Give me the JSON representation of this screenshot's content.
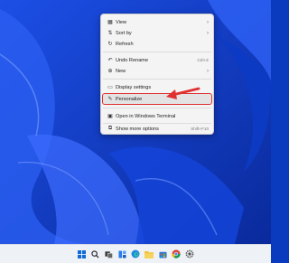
{
  "context_menu": {
    "items": [
      {
        "label": "View",
        "icon": "view-grid-icon",
        "submenu": true
      },
      {
        "label": "Sort by",
        "icon": "sort-icon",
        "submenu": true
      },
      {
        "label": "Refresh",
        "icon": "refresh-icon"
      },
      {
        "label": "Undo Rename",
        "icon": "undo-icon",
        "shortcut": "Ctrl+Z"
      },
      {
        "label": "New",
        "icon": "new-icon",
        "submenu": true
      },
      {
        "label": "Display settings",
        "icon": "display-icon"
      },
      {
        "label": "Personalize",
        "icon": "brush-icon",
        "highlighted": true
      },
      {
        "label": "Open in Windows Terminal",
        "icon": "terminal-icon"
      },
      {
        "label": "Show more options",
        "icon": "more-options-icon",
        "shortcut": "Shift+F10"
      }
    ]
  },
  "annotation": {
    "arrow_color": "#e03131"
  },
  "taskbar": {
    "icons": [
      "windows-start-icon",
      "search-icon",
      "task-view-icon",
      "widgets-icon",
      "edge-icon",
      "file-explorer-icon",
      "store-icon",
      "chrome-icon",
      "settings-icon"
    ]
  },
  "colors": {
    "wallpaper": "#0a3bbf",
    "highlight_border": "#e03131",
    "menu_bg": "#f4f4f4"
  }
}
